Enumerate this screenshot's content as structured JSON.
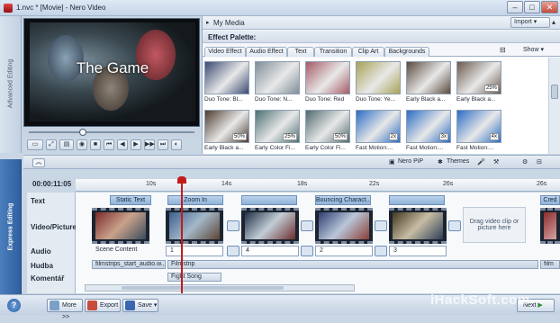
{
  "window": {
    "title": "1.nvc * [Movie] - Nero Video",
    "controls": [
      "–",
      "□",
      "✕"
    ]
  },
  "left_tabs": {
    "advanced_editing": "Advanced Editing",
    "express_editing": "Express Editing"
  },
  "preview": {
    "title_overlay": "The Game"
  },
  "right_panel": {
    "my_media_label": "My Media",
    "import_label": "Import",
    "effect_palette_label": "Effect Palette:",
    "tabs": [
      {
        "label": "Video Effect",
        "active": true
      },
      {
        "label": "Audio Effect",
        "active": false
      },
      {
        "label": "Text",
        "active": false
      },
      {
        "label": "Transition",
        "active": false
      },
      {
        "label": "Clip Art",
        "active": false
      },
      {
        "label": "Backgrounds",
        "active": false
      }
    ],
    "show_label": "Show",
    "effects": [
      {
        "label": "Duo Tone: Bl...",
        "badge": "",
        "color": "#3a4a72"
      },
      {
        "label": "Duo Tone: N...",
        "badge": "",
        "color": "#7f8e98"
      },
      {
        "label": "Duo Tone: Red",
        "badge": "",
        "color": "#a65a66"
      },
      {
        "label": "Duo Tone: Ye...",
        "badge": "",
        "color": "#a8a257"
      },
      {
        "label": "Early Black a...",
        "badge": "",
        "color": "#5a4a3e"
      },
      {
        "label": "Early Black a...",
        "badge": "25%",
        "color": "#6a5a4e"
      },
      {
        "label": "Early Black a...",
        "badge": "50%",
        "color": "#4d3c30"
      },
      {
        "label": "Early Color Fi...",
        "badge": "25%",
        "color": "#4c6f72"
      },
      {
        "label": "Early Color Fi...",
        "badge": "50%",
        "color": "#4f6a6d"
      },
      {
        "label": "Fast Motion:...",
        "badge": "2x",
        "color": "#2b6cc4"
      },
      {
        "label": "Fast Motion:...",
        "badge": "3x",
        "color": "#2b6cc4"
      },
      {
        "label": "Fast Motion:...",
        "badge": "4x",
        "color": "#2b6cc4"
      }
    ]
  },
  "sub_toolbar": {
    "nero_pip": "Nero PiP",
    "themes": "Themes"
  },
  "timeline": {
    "timecode": "00:00:11:05",
    "ruler_ticks": [
      "10s",
      "14s",
      "18s",
      "22s",
      "26s",
      "26s"
    ],
    "track_labels": {
      "text": "Text",
      "video": "Video/Picture",
      "audio": "Audio",
      "music": "Hudba",
      "narration": "Komentář"
    },
    "text_clips": [
      "Static Text",
      "Zoom In",
      "Bouncing Charact...",
      "Cred"
    ],
    "audio_items": [
      "Scene Content",
      "1",
      "4",
      "2",
      "3"
    ],
    "drop_zone": "Drag video clip or picture here",
    "music_clips": [
      "filmstrips_start_audio.w...",
      "Filmstrip",
      "film"
    ],
    "narration_clip": "Fight Song"
  },
  "bottom_bar": {
    "more_label": "More >>",
    "export_label": "Export",
    "save_label": "Save",
    "next_label": "Next"
  },
  "watermark": "iHackSoft.com"
}
